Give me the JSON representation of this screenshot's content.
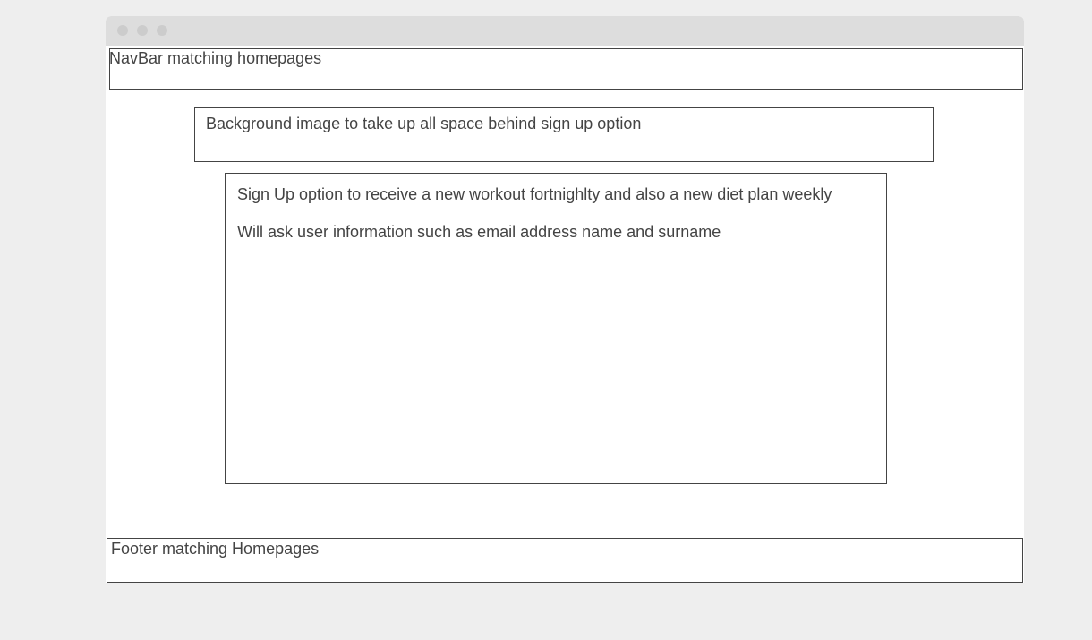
{
  "navbar": {
    "label": "NavBar matching homepages"
  },
  "background": {
    "label": "Background image to take up all space behind sign up option"
  },
  "signup": {
    "line1": "Sign Up option to receive a new workout fortnighlty and also a new diet plan weekly",
    "line2": "Will ask user information such as email address name and surname"
  },
  "footer": {
    "label": "Footer matching Homepages"
  }
}
